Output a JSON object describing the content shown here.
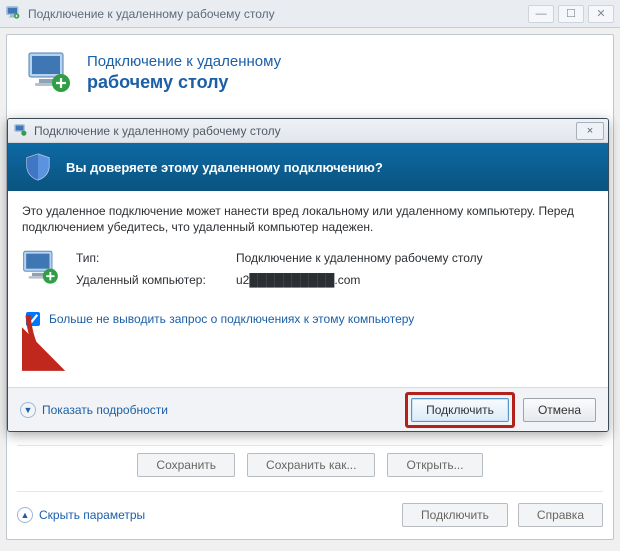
{
  "back_window": {
    "title": "Подключение к удаленному рабочему столу",
    "header_line1": "Подключение к удаленному",
    "header_line2": "рабочему столу",
    "buttons": {
      "save": "Сохранить",
      "save_as": "Сохранить как...",
      "open": "Открыть..."
    },
    "collapse_label": "Скрыть параметры",
    "connect": "Подключить",
    "help": "Справка"
  },
  "modal": {
    "title": "Подключение к удаленному рабочему столу",
    "close_label": "×",
    "band_question": "Вы доверяете этому удаленному подключению?",
    "body_text": "Это удаленное подключение может нанести вред локальному или удаленному компьютеру. Перед подключением убедитесь, что удаленный компьютер надежен.",
    "rows": {
      "type_label": "Тип:",
      "type_value": "Подключение к удаленному рабочему столу",
      "host_label": "Удаленный компьютер:",
      "host_value": "u2██████████.com"
    },
    "checkbox_label": "Больше не выводить запрос о подключениях к этому компьютеру",
    "details_label": "Показать подробности",
    "connect_btn": "Подключить",
    "cancel_btn": "Отмена"
  },
  "colors": {
    "accent": "#1b5fa7",
    "band_top": "#0d6aa4",
    "band_bottom": "#0a537f",
    "highlight_red": "#b3211a"
  }
}
